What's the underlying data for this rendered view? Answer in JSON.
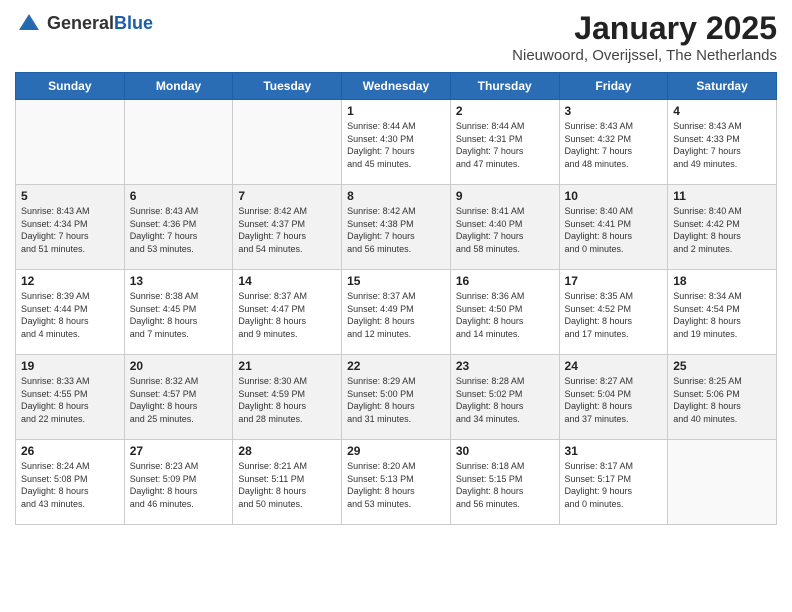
{
  "header": {
    "logo": {
      "text_general": "General",
      "text_blue": "Blue"
    },
    "title": "January 2025",
    "subtitle": "Nieuwoord, Overijssel, The Netherlands"
  },
  "days_of_week": [
    "Sunday",
    "Monday",
    "Tuesday",
    "Wednesday",
    "Thursday",
    "Friday",
    "Saturday"
  ],
  "weeks": [
    {
      "days": [
        {
          "num": "",
          "info": ""
        },
        {
          "num": "",
          "info": ""
        },
        {
          "num": "",
          "info": ""
        },
        {
          "num": "1",
          "info": "Sunrise: 8:44 AM\nSunset: 4:30 PM\nDaylight: 7 hours\nand 45 minutes."
        },
        {
          "num": "2",
          "info": "Sunrise: 8:44 AM\nSunset: 4:31 PM\nDaylight: 7 hours\nand 47 minutes."
        },
        {
          "num": "3",
          "info": "Sunrise: 8:43 AM\nSunset: 4:32 PM\nDaylight: 7 hours\nand 48 minutes."
        },
        {
          "num": "4",
          "info": "Sunrise: 8:43 AM\nSunset: 4:33 PM\nDaylight: 7 hours\nand 49 minutes."
        }
      ]
    },
    {
      "days": [
        {
          "num": "5",
          "info": "Sunrise: 8:43 AM\nSunset: 4:34 PM\nDaylight: 7 hours\nand 51 minutes."
        },
        {
          "num": "6",
          "info": "Sunrise: 8:43 AM\nSunset: 4:36 PM\nDaylight: 7 hours\nand 53 minutes."
        },
        {
          "num": "7",
          "info": "Sunrise: 8:42 AM\nSunset: 4:37 PM\nDaylight: 7 hours\nand 54 minutes."
        },
        {
          "num": "8",
          "info": "Sunrise: 8:42 AM\nSunset: 4:38 PM\nDaylight: 7 hours\nand 56 minutes."
        },
        {
          "num": "9",
          "info": "Sunrise: 8:41 AM\nSunset: 4:40 PM\nDaylight: 7 hours\nand 58 minutes."
        },
        {
          "num": "10",
          "info": "Sunrise: 8:40 AM\nSunset: 4:41 PM\nDaylight: 8 hours\nand 0 minutes."
        },
        {
          "num": "11",
          "info": "Sunrise: 8:40 AM\nSunset: 4:42 PM\nDaylight: 8 hours\nand 2 minutes."
        }
      ]
    },
    {
      "days": [
        {
          "num": "12",
          "info": "Sunrise: 8:39 AM\nSunset: 4:44 PM\nDaylight: 8 hours\nand 4 minutes."
        },
        {
          "num": "13",
          "info": "Sunrise: 8:38 AM\nSunset: 4:45 PM\nDaylight: 8 hours\nand 7 minutes."
        },
        {
          "num": "14",
          "info": "Sunrise: 8:37 AM\nSunset: 4:47 PM\nDaylight: 8 hours\nand 9 minutes."
        },
        {
          "num": "15",
          "info": "Sunrise: 8:37 AM\nSunset: 4:49 PM\nDaylight: 8 hours\nand 12 minutes."
        },
        {
          "num": "16",
          "info": "Sunrise: 8:36 AM\nSunset: 4:50 PM\nDaylight: 8 hours\nand 14 minutes."
        },
        {
          "num": "17",
          "info": "Sunrise: 8:35 AM\nSunset: 4:52 PM\nDaylight: 8 hours\nand 17 minutes."
        },
        {
          "num": "18",
          "info": "Sunrise: 8:34 AM\nSunset: 4:54 PM\nDaylight: 8 hours\nand 19 minutes."
        }
      ]
    },
    {
      "days": [
        {
          "num": "19",
          "info": "Sunrise: 8:33 AM\nSunset: 4:55 PM\nDaylight: 8 hours\nand 22 minutes."
        },
        {
          "num": "20",
          "info": "Sunrise: 8:32 AM\nSunset: 4:57 PM\nDaylight: 8 hours\nand 25 minutes."
        },
        {
          "num": "21",
          "info": "Sunrise: 8:30 AM\nSunset: 4:59 PM\nDaylight: 8 hours\nand 28 minutes."
        },
        {
          "num": "22",
          "info": "Sunrise: 8:29 AM\nSunset: 5:00 PM\nDaylight: 8 hours\nand 31 minutes."
        },
        {
          "num": "23",
          "info": "Sunrise: 8:28 AM\nSunset: 5:02 PM\nDaylight: 8 hours\nand 34 minutes."
        },
        {
          "num": "24",
          "info": "Sunrise: 8:27 AM\nSunset: 5:04 PM\nDaylight: 8 hours\nand 37 minutes."
        },
        {
          "num": "25",
          "info": "Sunrise: 8:25 AM\nSunset: 5:06 PM\nDaylight: 8 hours\nand 40 minutes."
        }
      ]
    },
    {
      "days": [
        {
          "num": "26",
          "info": "Sunrise: 8:24 AM\nSunset: 5:08 PM\nDaylight: 8 hours\nand 43 minutes."
        },
        {
          "num": "27",
          "info": "Sunrise: 8:23 AM\nSunset: 5:09 PM\nDaylight: 8 hours\nand 46 minutes."
        },
        {
          "num": "28",
          "info": "Sunrise: 8:21 AM\nSunset: 5:11 PM\nDaylight: 8 hours\nand 50 minutes."
        },
        {
          "num": "29",
          "info": "Sunrise: 8:20 AM\nSunset: 5:13 PM\nDaylight: 8 hours\nand 53 minutes."
        },
        {
          "num": "30",
          "info": "Sunrise: 8:18 AM\nSunset: 5:15 PM\nDaylight: 8 hours\nand 56 minutes."
        },
        {
          "num": "31",
          "info": "Sunrise: 8:17 AM\nSunset: 5:17 PM\nDaylight: 9 hours\nand 0 minutes."
        },
        {
          "num": "",
          "info": ""
        }
      ]
    }
  ]
}
